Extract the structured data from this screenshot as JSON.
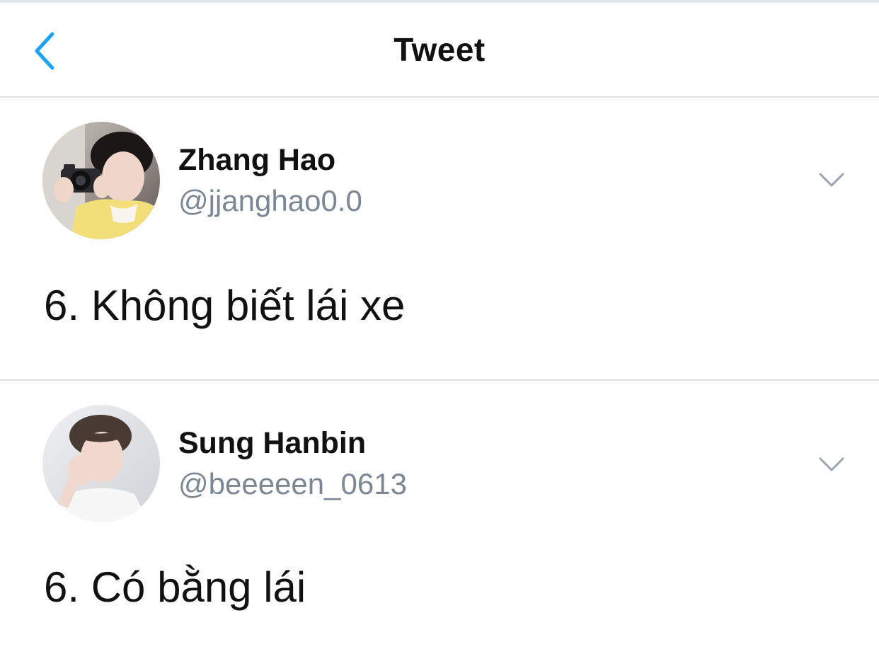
{
  "nav": {
    "title": "Tweet",
    "back_icon": "chevron-left-icon",
    "accent_color": "#1da1f2"
  },
  "tweets": [
    {
      "display_name": "Zhang Hao",
      "handle": "@jjanghao0.0",
      "text": "6. Không biết lái xe",
      "avatar_icon": "avatar-photo",
      "menu_icon": "chevron-down-icon"
    },
    {
      "display_name": "Sung Hanbin",
      "handle": "@beeeeen_0613",
      "text": "6. Có bằng lái",
      "avatar_icon": "avatar-photo",
      "menu_icon": "chevron-down-icon"
    }
  ],
  "colors": {
    "handle": "#7b8893",
    "divider": "#dcdfe3",
    "text": "#111111"
  }
}
